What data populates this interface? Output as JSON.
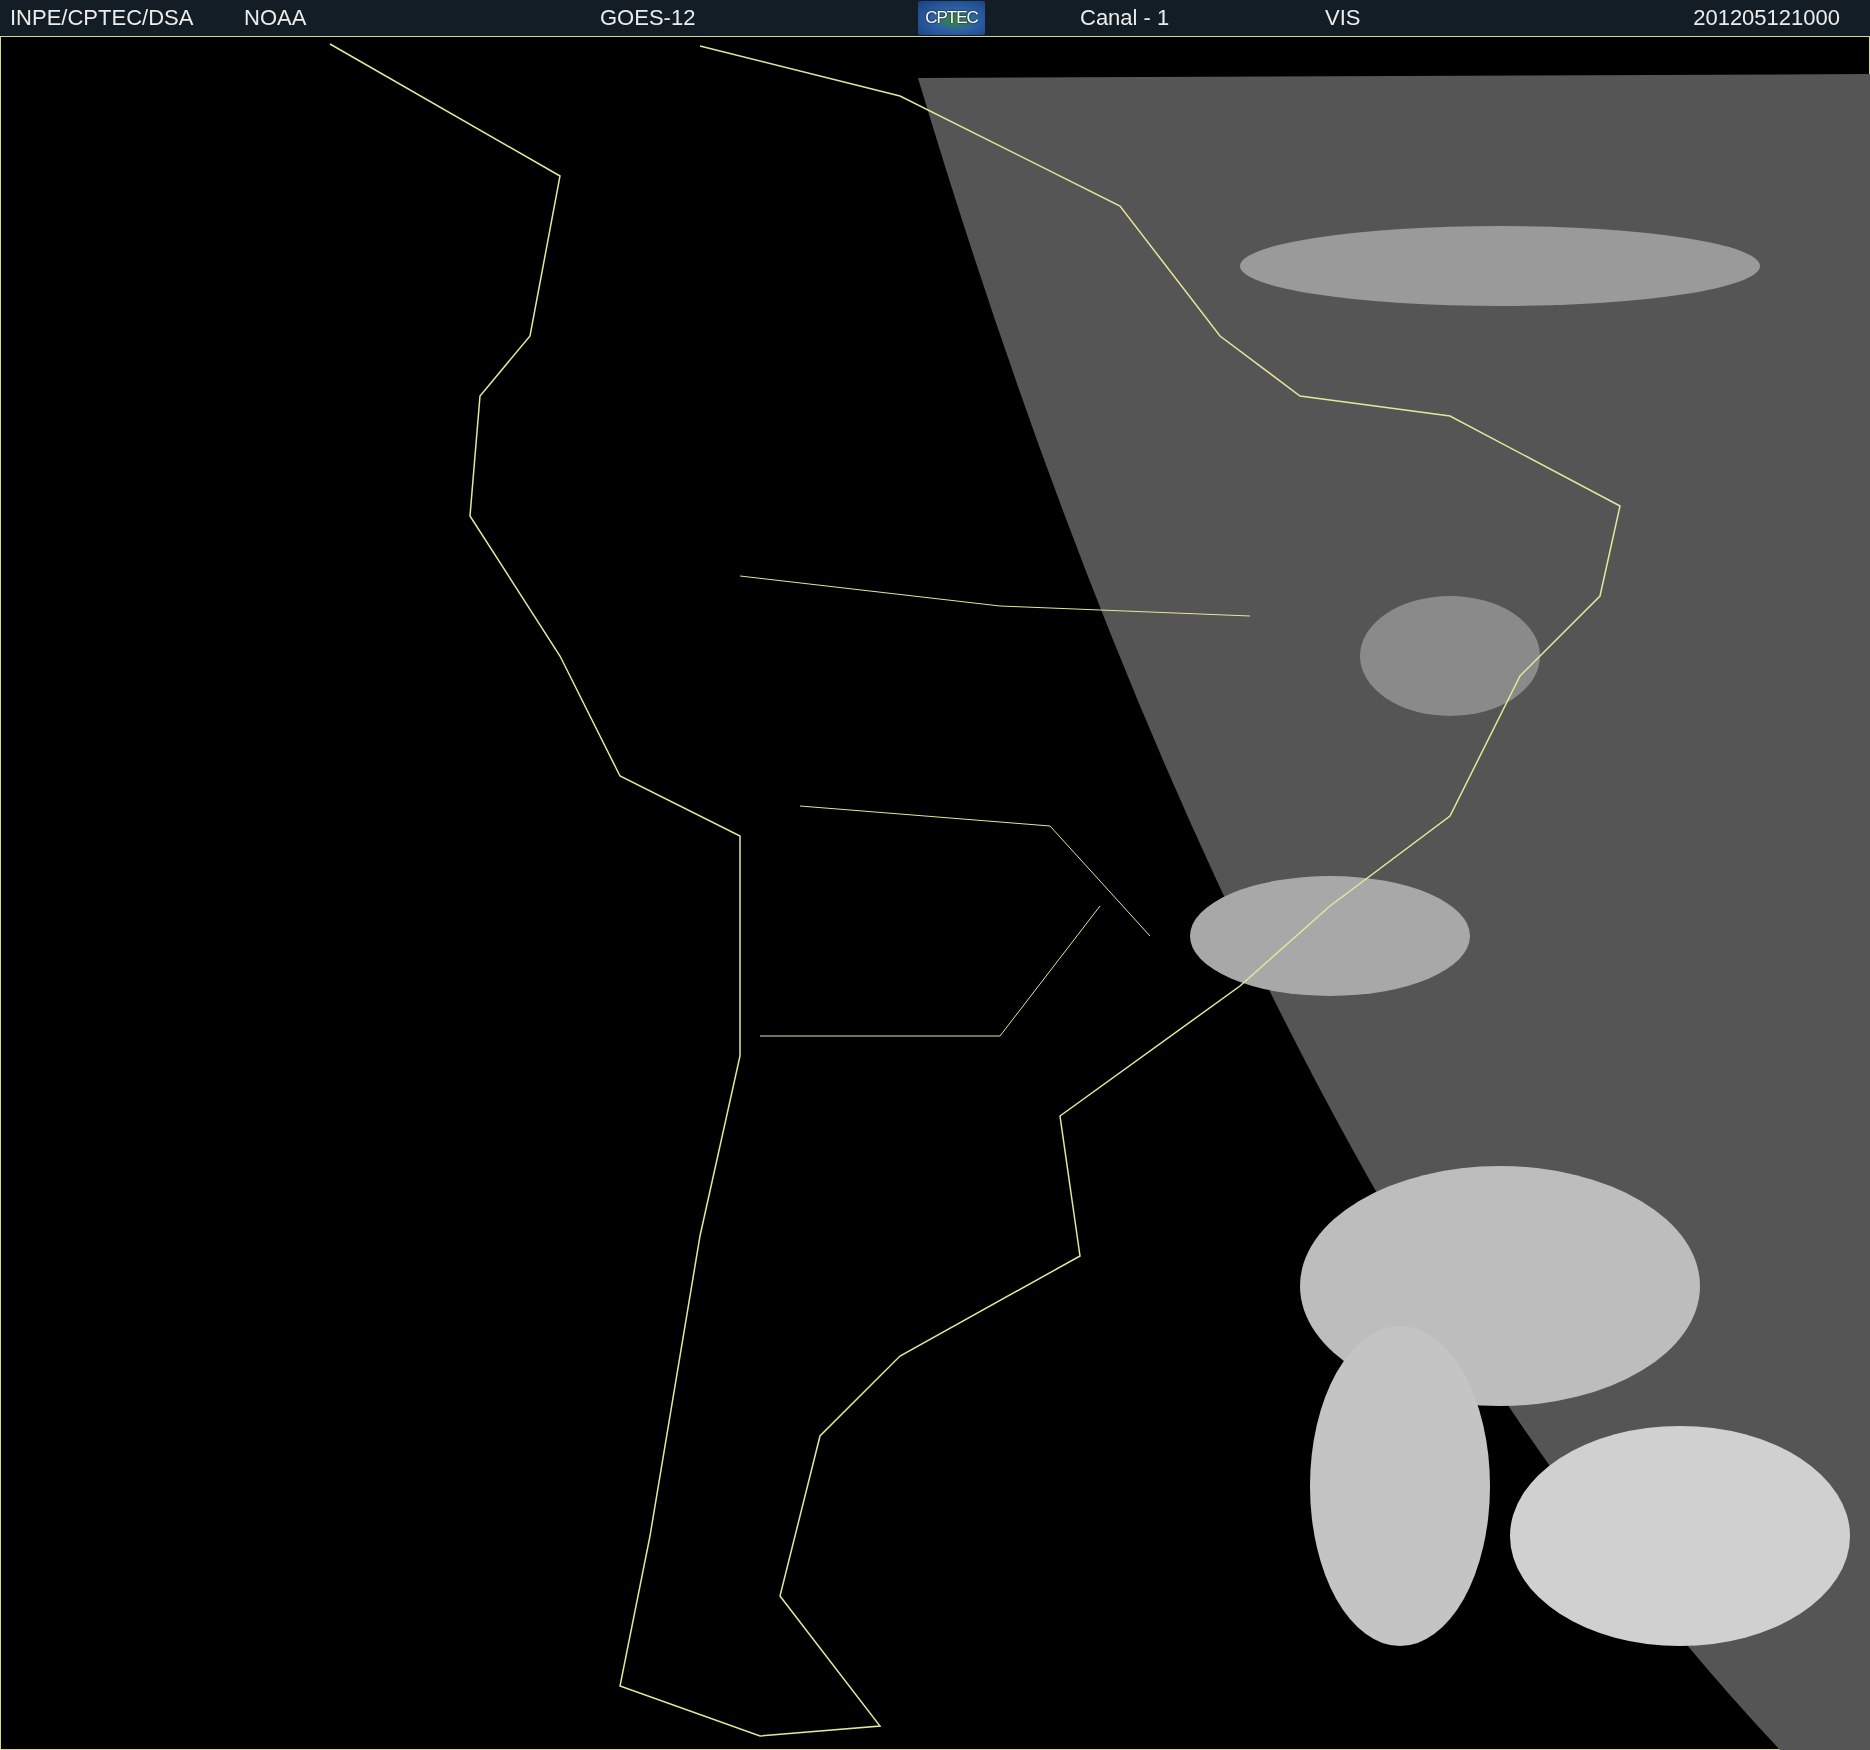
{
  "header": {
    "source": "INPE/CPTEC/DSA",
    "agency": "NOAA",
    "satellite": "GOES-12",
    "logo": "CPTEC",
    "channel": "Canal - 1",
    "band": "VIS",
    "timestamp": "201205121000"
  }
}
